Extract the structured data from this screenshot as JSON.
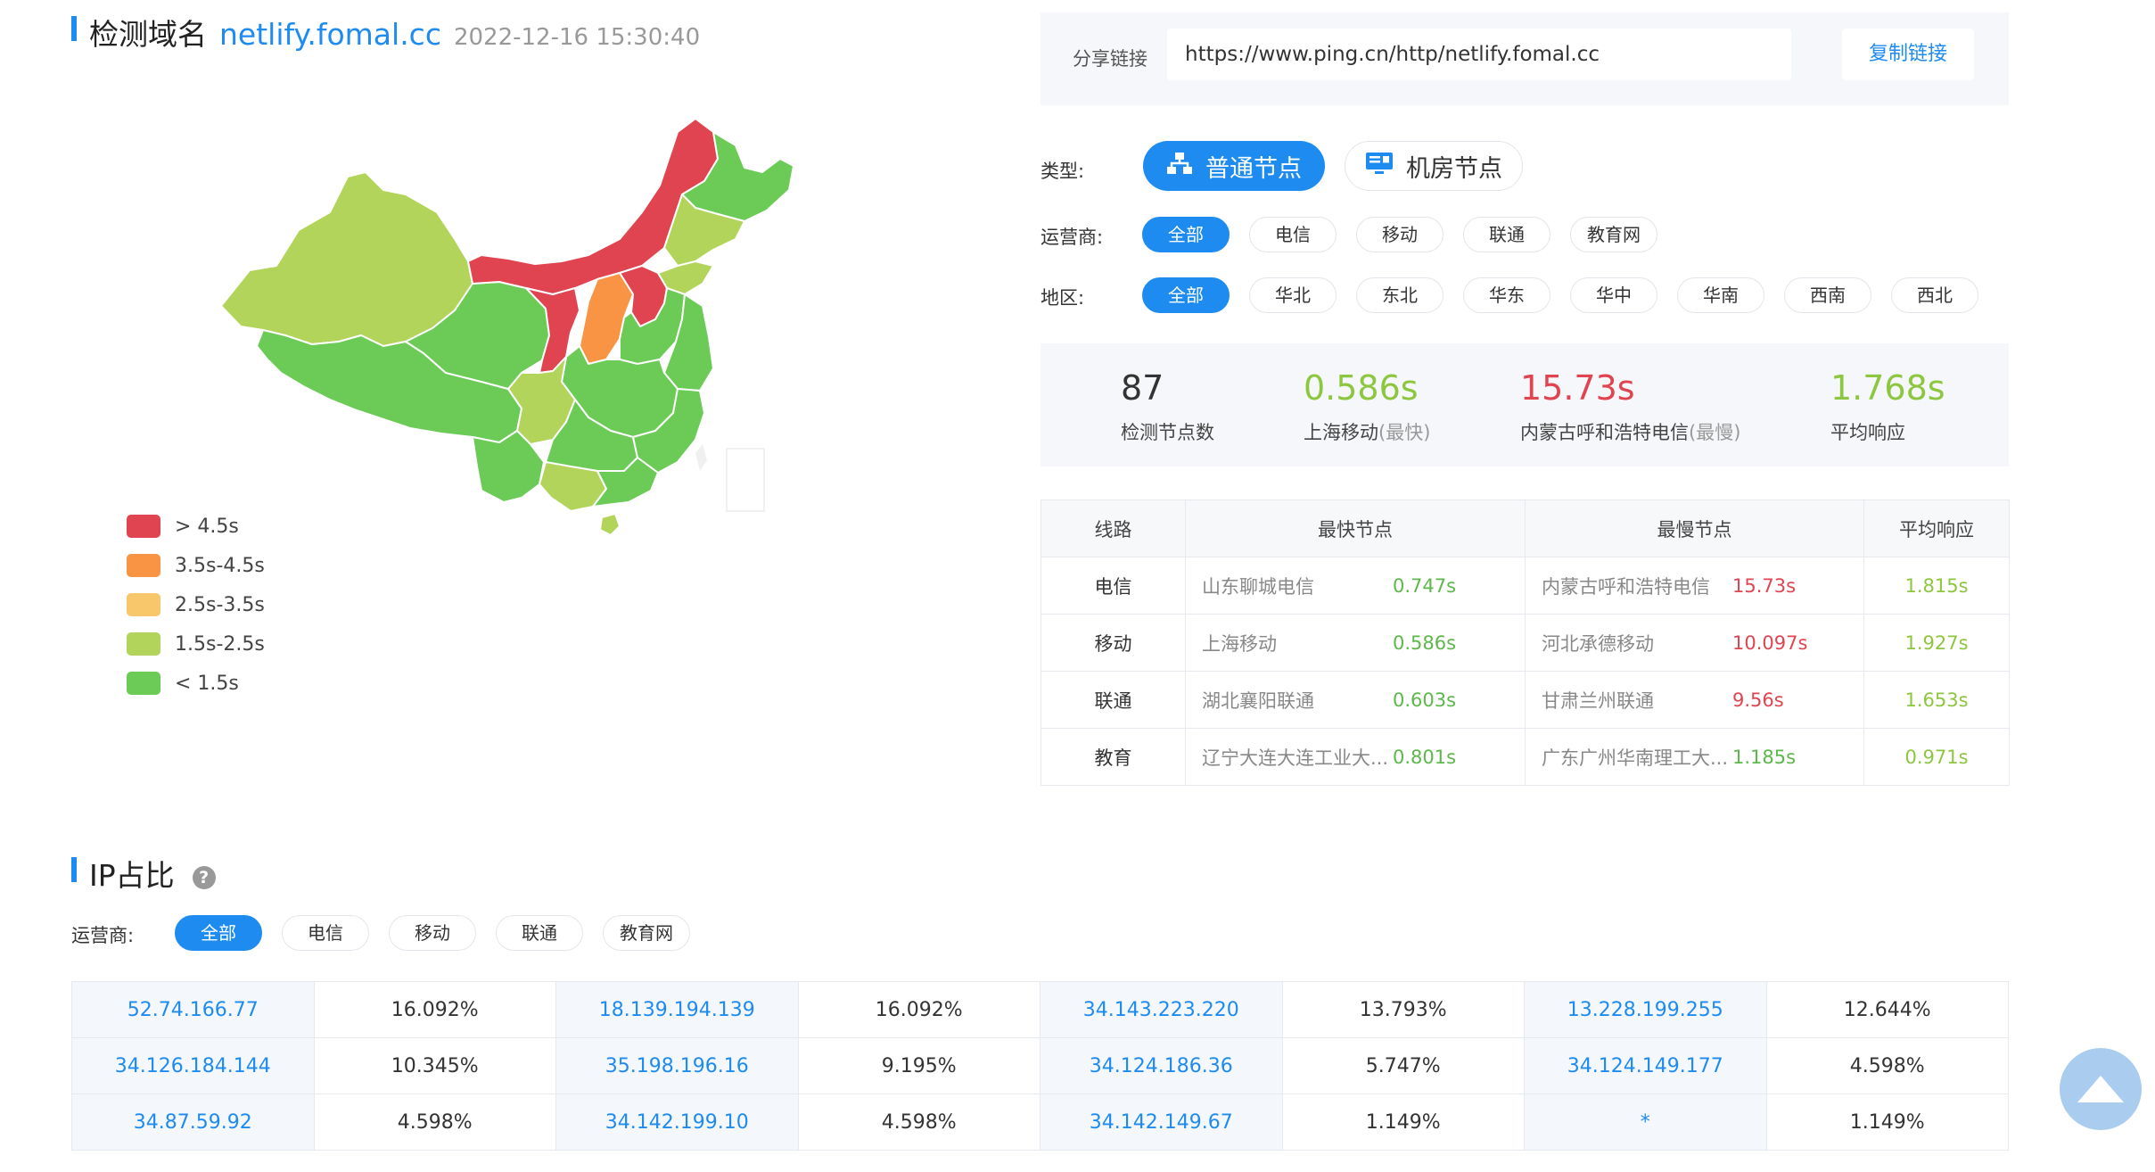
{
  "header": {
    "title": "检测域名",
    "domain": "netlify.fomal.cc",
    "datetime": "2022-12-16 15:30:40"
  },
  "map": {
    "legend": [
      {
        "label": "> 4.5s",
        "color": "#e04450"
      },
      {
        "label": "3.5s-4.5s",
        "color": "#f99444"
      },
      {
        "label": "2.5s-3.5s",
        "color": "#f8c66b"
      },
      {
        "label": "1.5s-2.5s",
        "color": "#b2d45a"
      },
      {
        "label": "< 1.5s",
        "color": "#6cca57"
      }
    ]
  },
  "share": {
    "label": "分享链接",
    "url": "https://www.ping.cn/http/netlify.fomal.cc",
    "copy_label": "复制链接"
  },
  "filters": {
    "type_label": "类型:",
    "types": [
      {
        "label": "普通节点",
        "icon": "network-nodes-icon",
        "active": true
      },
      {
        "label": "机房节点",
        "icon": "server-monitor-icon",
        "active": false
      }
    ],
    "isp_label": "运营商:",
    "isps": [
      "全部",
      "电信",
      "移动",
      "联通",
      "教育网"
    ],
    "region_label": "地区:",
    "regions": [
      "全部",
      "华北",
      "东北",
      "华东",
      "华中",
      "华南",
      "西南",
      "西北"
    ]
  },
  "stats": {
    "count": {
      "value": "87",
      "label": "检测节点数"
    },
    "fastest": {
      "value": "0.586s",
      "label": "上海移动",
      "sub": "(最快)"
    },
    "slowest": {
      "value": "15.73s",
      "label": "内蒙古呼和浩特电信",
      "sub": "(最慢)"
    },
    "average": {
      "value": "1.768s",
      "label": "平均响应"
    }
  },
  "line_table": {
    "headers": [
      "线路",
      "最快节点",
      "最慢节点",
      "平均响应"
    ],
    "rows": [
      {
        "line": "电信",
        "fast_name": "山东聊城电信",
        "fast_time": "0.747s",
        "slow_name": "内蒙古呼和浩特电信",
        "slow_time": "15.73s",
        "avg": "1.815s"
      },
      {
        "line": "移动",
        "fast_name": "上海移动",
        "fast_time": "0.586s",
        "slow_name": "河北承德移动",
        "slow_time": "10.097s",
        "avg": "1.927s"
      },
      {
        "line": "联通",
        "fast_name": "湖北襄阳联通",
        "fast_time": "0.603s",
        "slow_name": "甘肃兰州联通",
        "slow_time": "9.56s",
        "avg": "1.653s"
      },
      {
        "line": "教育",
        "fast_name": "辽宁大连大连工业大...",
        "fast_time": "0.801s",
        "slow_name": "广东广州华南理工大...",
        "slow_time": "1.185s",
        "avg": "0.971s"
      }
    ]
  },
  "ip_section": {
    "title": "IP占比",
    "help_icon": "?",
    "isp_label": "运营商:",
    "isps": [
      "全部",
      "电信",
      "移动",
      "联通",
      "教育网"
    ],
    "rows": [
      [
        {
          "ip": "52.74.166.77",
          "pct": "16.092%"
        },
        {
          "ip": "18.139.194.139",
          "pct": "16.092%"
        },
        {
          "ip": "34.143.223.220",
          "pct": "13.793%"
        },
        {
          "ip": "13.228.199.255",
          "pct": "12.644%"
        }
      ],
      [
        {
          "ip": "34.126.184.144",
          "pct": "10.345%"
        },
        {
          "ip": "35.198.196.16",
          "pct": "9.195%"
        },
        {
          "ip": "34.124.186.36",
          "pct": "5.747%"
        },
        {
          "ip": "34.124.149.177",
          "pct": "4.598%"
        }
      ],
      [
        {
          "ip": "34.87.59.92",
          "pct": "4.598%"
        },
        {
          "ip": "34.142.199.10",
          "pct": "4.598%"
        },
        {
          "ip": "34.142.149.67",
          "pct": "1.149%"
        },
        {
          "ip": "*",
          "pct": "1.149%"
        }
      ]
    ]
  }
}
